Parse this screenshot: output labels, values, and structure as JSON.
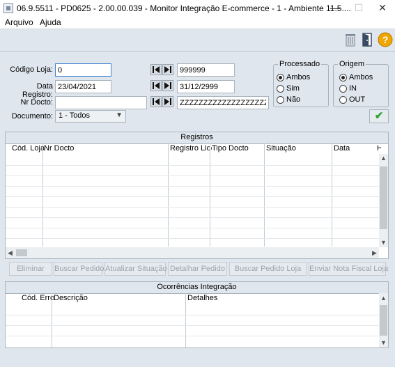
{
  "window": {
    "title": "06.9.5511 - PD0625 - 2.00.00.039 - Monitor Integração E-commerce - 1 - Ambiente 11.5....",
    "controls": {
      "minimize": "—",
      "maximize": "☐",
      "close": "✕"
    }
  },
  "menu": {
    "items": [
      "Arquivo",
      "Ajuda"
    ]
  },
  "toolbar": {
    "icons": [
      "trash-icon",
      "exit-door-icon",
      "help-icon"
    ],
    "help_color": "#f0a500"
  },
  "filters": {
    "codigo_loja": {
      "label": "Código Loja:",
      "from": "0",
      "to": "999999"
    },
    "data_registro": {
      "label": "Data Registro:",
      "from": "23/04/2021",
      "to": "31/12/2999"
    },
    "nr_docto": {
      "label": "Nr Docto:",
      "from": "",
      "to": "ZZZZZZZZZZZZZZZZZZZZZZZZZZZZ"
    },
    "documento": {
      "label": "Documento:",
      "value": "1 - Todos"
    }
  },
  "processado": {
    "title": "Processado",
    "options": [
      "Ambos",
      "Sim",
      "Não"
    ],
    "selected": "Ambos"
  },
  "origem": {
    "title": "Origem",
    "options": [
      "Ambos",
      "IN",
      "OUT"
    ],
    "selected": "Ambos"
  },
  "confirm": {
    "symbol": "✔",
    "color": "#2fa12f"
  },
  "registros": {
    "title": "Registros",
    "columns": [
      "Cód. Loja",
      "Nr Docto",
      "Registro Lido",
      "Tipo Docto",
      "Situação",
      "Data",
      "H"
    ]
  },
  "actions": [
    "Eliminar",
    "Buscar Pedido",
    "Atualizar Situação",
    "Detalhar Pedido",
    "Buscar Pedido Loja",
    "Enviar Nota Fiscal Loja"
  ],
  "ocorrencias": {
    "title": "Ocorrências Integração",
    "columns": [
      "Cód. Erro",
      "Descrição",
      "Detalhes"
    ]
  }
}
